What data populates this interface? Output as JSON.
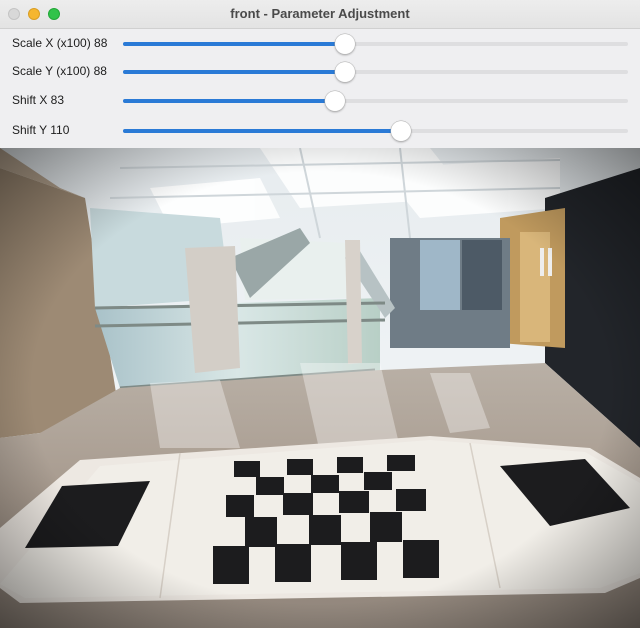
{
  "window": {
    "title": "front - Parameter Adjustment"
  },
  "sliders": [
    {
      "label": "Scale X (x100) 88",
      "value": 0.44
    },
    {
      "label": "Scale Y (x100) 88",
      "value": 0.44
    },
    {
      "label": "Shift X 83",
      "value": 0.42
    },
    {
      "label": "Shift Y 110",
      "value": 0.55
    }
  ],
  "colors": {
    "accent": "#2a7ad6",
    "track": "#dedee0"
  },
  "image": {
    "description_icon": "camera-feed"
  }
}
